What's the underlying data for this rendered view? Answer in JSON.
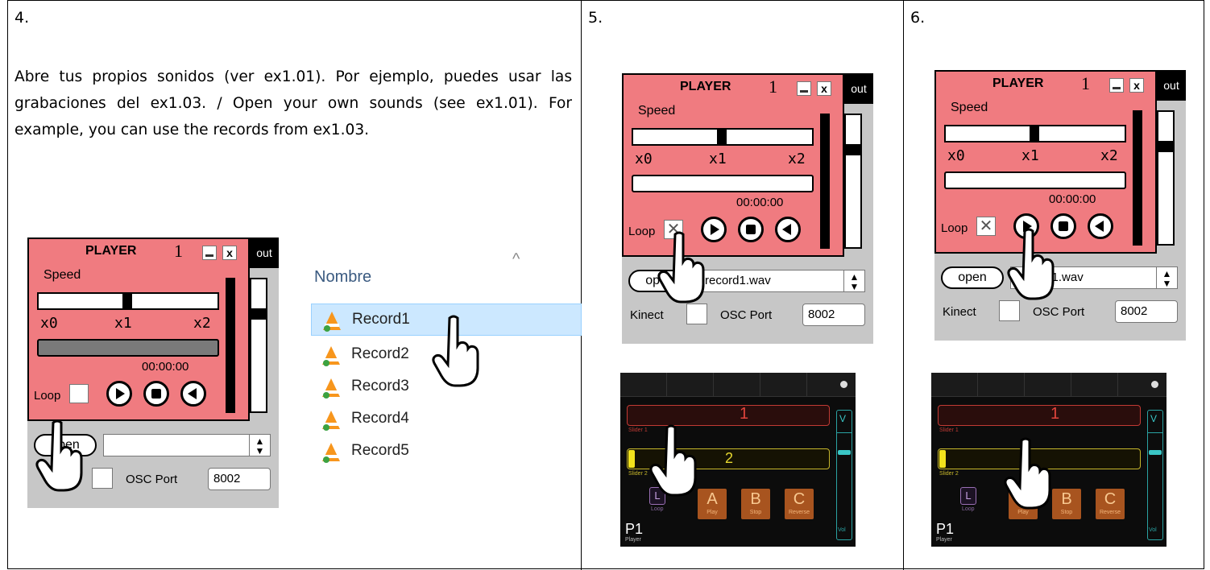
{
  "cells": {
    "c4": {
      "number": "4.",
      "text": "Abre tus propios sonidos (ver ex1.01). Por ejemplo, puedes usar las grabaciones del ex1.03. / Open your own sounds (see ex1.01). For example, you can use the records from ex1.03."
    },
    "c5": {
      "number": "5."
    },
    "c6": {
      "number": "6."
    }
  },
  "player": {
    "title": "PLAYER",
    "number": "1",
    "close": "x",
    "out": "out",
    "speed_label": "Speed",
    "x0": "x0",
    "x1": "x1",
    "x2": "x2",
    "time": "00:00:00",
    "loop_label": "Loop",
    "open_label": "open",
    "file_step4": "",
    "file_step5": "record1.wav",
    "file_step6": "record1.wav",
    "kinect_label": "Kinect",
    "osc_label": "OSC Port",
    "osc_port": "8002"
  },
  "filelist": {
    "header": "Nombre",
    "items": [
      "Record1",
      "Record2",
      "Record3",
      "Record4",
      "Record5"
    ],
    "selected": "Record1"
  },
  "phone": {
    "slider1_value": "1",
    "slider1_label": "Slider 1",
    "slider2_value": "2",
    "slider2_label": "Slider 2",
    "loop_button": "L",
    "loop_label": "Loop",
    "buttons": [
      {
        "letter": "A",
        "label": "Play"
      },
      {
        "letter": "B",
        "label": "Stop"
      },
      {
        "letter": "C",
        "label": "Reverse"
      }
    ],
    "vol_top": "V",
    "vol_label": "Vol",
    "page_title": "P1",
    "page_sub": "Player"
  },
  "colors": {
    "player_pink": "#f07b80",
    "panel_gray": "#c7c7c7",
    "selection_blue": "#cce8ff",
    "phone_bg": "#0c0c0c",
    "slider1": "#c23a34",
    "slider2": "#c7b72b",
    "button_orange": "#a8541f",
    "vol_teal": "#2aa3a3"
  }
}
